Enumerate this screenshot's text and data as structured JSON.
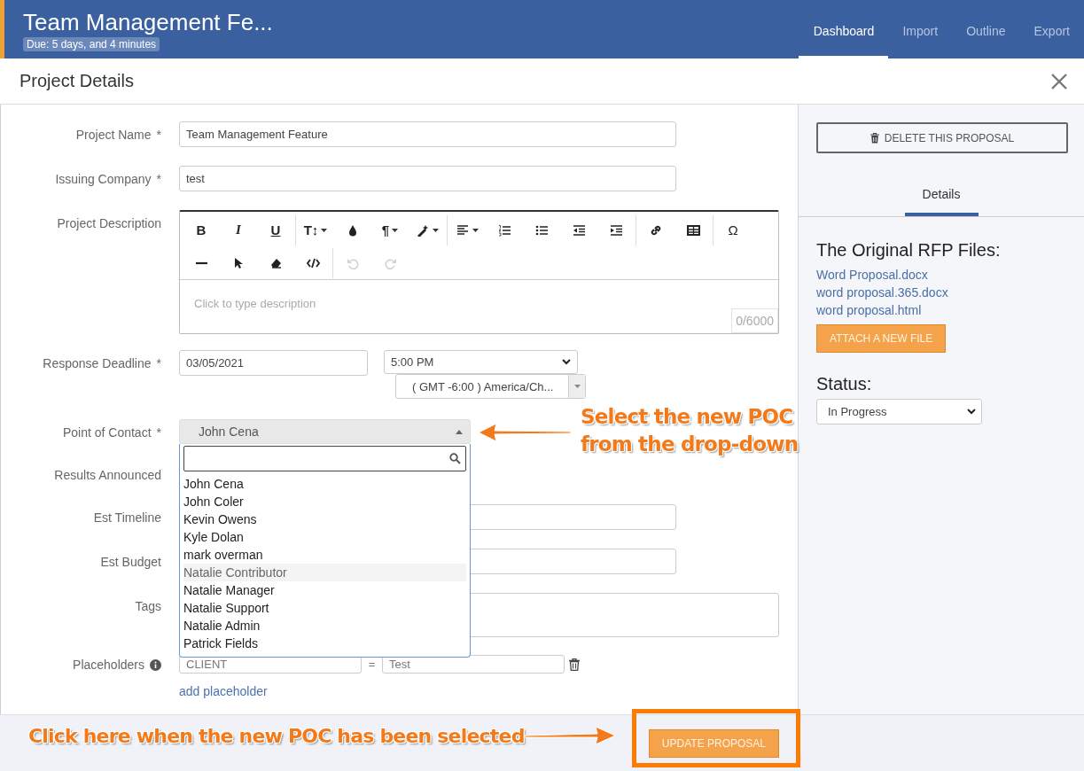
{
  "header": {
    "title": "Team Management Fe...",
    "due": "Due: 5 days, and 4 minutes",
    "nav": [
      {
        "label": "Dashboard",
        "selected": true
      },
      {
        "label": "Import",
        "selected": false
      },
      {
        "label": "Outline",
        "selected": false
      },
      {
        "label": "Export",
        "selected": false
      }
    ]
  },
  "modal": {
    "title": "Project Details"
  },
  "fields": [
    {
      "kind": "text",
      "label": "Project Name",
      "marker": "*",
      "value": "Team Management Feature"
    },
    {
      "kind": "text",
      "label": "Issuing Company",
      "marker": "*",
      "value": "test"
    },
    {
      "kind": "editor",
      "label": "Project Description",
      "placeholder": "Click to type description",
      "counter": "0/6000",
      "toolbar_rows": [
        [
          [
            {
              "kind": "bold",
              "glyph": "B",
              "disabled": false
            },
            {
              "kind": "italic",
              "glyph": "I",
              "disabled": false
            },
            {
              "kind": "underline",
              "glyph": "U",
              "disabled": false
            }
          ],
          [
            {
              "kind": "textsize",
              "glyph": "T↕",
              "dropdown": true,
              "disabled": false
            },
            {
              "kind": "color",
              "disabled": false
            },
            {
              "kind": "paragraph",
              "glyph": "¶",
              "dropdown": true,
              "disabled": false
            },
            {
              "kind": "magic",
              "dropdown": true,
              "disabled": false
            }
          ],
          [
            {
              "kind": "align",
              "dropdown": true,
              "disabled": false
            },
            {
              "kind": "ol",
              "disabled": false
            },
            {
              "kind": "ul",
              "disabled": false
            },
            {
              "kind": "outdent",
              "disabled": false
            },
            {
              "kind": "indent",
              "disabled": false
            }
          ],
          [
            {
              "kind": "link",
              "disabled": false
            },
            {
              "kind": "table",
              "disabled": false
            }
          ],
          [
            {
              "kind": "symbol",
              "glyph": "Ω",
              "disabled": false
            }
          ]
        ],
        [
          [
            {
              "kind": "hr",
              "disabled": false
            },
            {
              "kind": "pointer",
              "disabled": false
            },
            {
              "kind": "eraser",
              "disabled": false
            },
            {
              "kind": "code",
              "disabled": false
            }
          ],
          [
            {
              "kind": "undo",
              "disabled": true
            },
            {
              "kind": "redo",
              "disabled": true
            }
          ]
        ]
      ]
    },
    {
      "kind": "deadline",
      "label": "Response Deadline",
      "marker": "*",
      "date": "03/05/2021",
      "time": "5:00 PM",
      "timezone": "( GMT -6:00 ) America/Ch..."
    },
    {
      "kind": "select",
      "label": "Point of Contact",
      "marker": "*",
      "value": "John Cena",
      "expanded": true,
      "options": [
        {
          "label": "John Cena",
          "highlighted": false
        },
        {
          "label": "John Coler",
          "highlighted": false
        },
        {
          "label": "Kevin Owens",
          "highlighted": false
        },
        {
          "label": "Kyle Dolan",
          "highlighted": false
        },
        {
          "label": "mark overman",
          "highlighted": false
        },
        {
          "label": "Natalie Contributor",
          "highlighted": true
        },
        {
          "label": "Natalie Manager",
          "highlighted": false
        },
        {
          "label": "Natalie Support",
          "highlighted": false
        },
        {
          "label": "Natalie Admin",
          "highlighted": false
        },
        {
          "label": "Patrick Fields",
          "highlighted": false
        }
      ]
    },
    {
      "kind": "covered",
      "label": "Results Announced"
    },
    {
      "kind": "text",
      "label": "Est Timeline"
    },
    {
      "kind": "text",
      "label": "Est Budget"
    },
    {
      "kind": "tags",
      "label": "Tags"
    },
    {
      "kind": "placeholders",
      "label": "Placeholders",
      "key": "CLIENT",
      "equals": "=",
      "value": "Test",
      "link": "add placeholder"
    }
  ],
  "footer": {
    "button": "UPDATE PROPOSAL"
  },
  "side": {
    "delete_button": "DELETE THIS PROPOSAL",
    "tabs": [
      {
        "label": "Details",
        "selected": true
      }
    ],
    "files_heading": "The Original RFP Files:",
    "files": [
      "Word Proposal.docx",
      "word proposal.365.docx",
      "word proposal.html"
    ],
    "attach_button": "ATTACH A NEW FILE",
    "status_label": "Status:",
    "status": "In Progress"
  },
  "annotations": [
    {
      "kind": "left",
      "text": "Select the new POC\nfrom the drop-down"
    },
    {
      "kind": "right",
      "text": "Click here when the new POC has been selected"
    }
  ]
}
